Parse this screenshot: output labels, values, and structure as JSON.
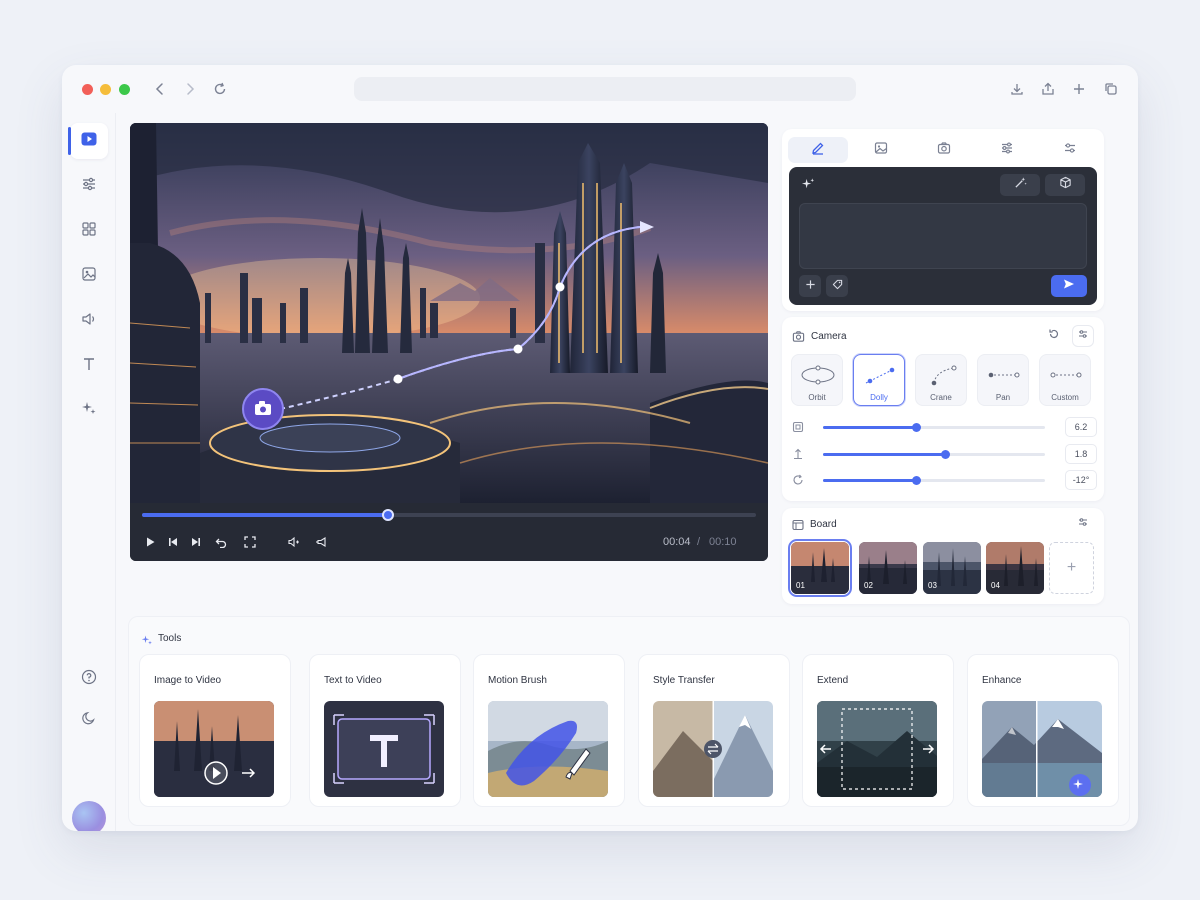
{
  "window": {
    "titlebar_icons": [
      "back-icon",
      "forward-icon",
      "reload-icon",
      "download-icon",
      "share-icon",
      "plus-icon",
      "copy-icon"
    ]
  },
  "sidebar": {
    "items": [
      {
        "icon": "play-icon",
        "active": true
      },
      {
        "icon": "sliders-icon",
        "active": false
      },
      {
        "icon": "grid-icon",
        "active": false
      },
      {
        "icon": "image-icon",
        "active": false
      },
      {
        "icon": "volume-icon",
        "active": false
      },
      {
        "icon": "text-icon",
        "active": false
      },
      {
        "icon": "sparkles-icon",
        "active": false
      }
    ],
    "bottom": [
      "help-icon",
      "moon-icon"
    ]
  },
  "player": {
    "progress": 0.4,
    "current_time": "00:04",
    "separator": "/",
    "total_time": "00:10",
    "accent": "#4b6cf0"
  },
  "panel": {
    "tabs": [
      "pen-icon",
      "image-icon",
      "camera-icon",
      "sliders-icon",
      "settings-icon"
    ],
    "prompt": {
      "placeholder": "",
      "send_color": "#4b6cf0"
    },
    "camera": {
      "title": "Camera",
      "modes": [
        {
          "label": "Orbit",
          "active": false
        },
        {
          "label": "Dolly",
          "active": true
        },
        {
          "label": "Crane",
          "active": false
        },
        {
          "label": "Pan",
          "active": false
        },
        {
          "label": "Custom",
          "active": false
        }
      ],
      "sliders": [
        {
          "icon": "zoom-icon",
          "value": "6.2",
          "level": 0.42
        },
        {
          "icon": "height-icon",
          "value": "1.8",
          "level": 0.55
        },
        {
          "icon": "rotate-icon",
          "value": "-12°",
          "level": 0.42
        }
      ]
    },
    "board": {
      "title": "Board",
      "frames": [
        "01",
        "02",
        "03",
        "04"
      ],
      "add_label": "+"
    }
  },
  "tools": {
    "title": "Tools",
    "items": [
      {
        "label": "Image to Video"
      },
      {
        "label": "Text to Video"
      },
      {
        "label": "Motion Brush"
      },
      {
        "label": "Style Transfer"
      },
      {
        "label": "Extend"
      },
      {
        "label": "Enhance"
      }
    ]
  }
}
